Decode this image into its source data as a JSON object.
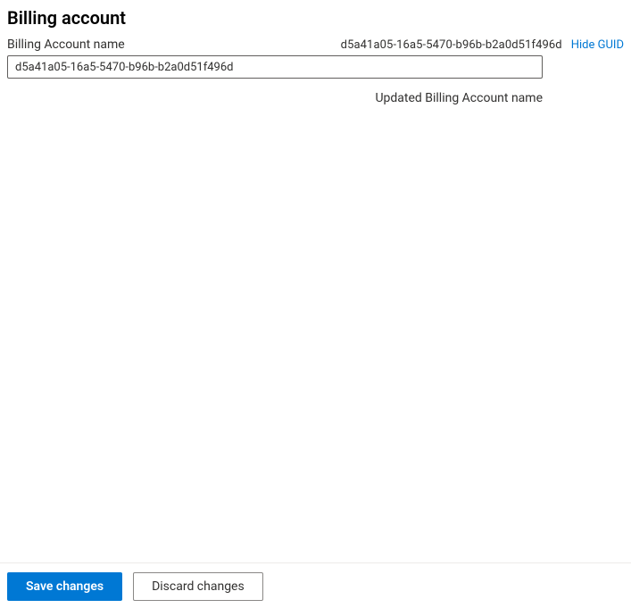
{
  "header": {
    "title": "Billing account"
  },
  "form": {
    "field_label": "Billing Account name",
    "guid": "d5a41a05-16a5-5470-b96b-b2a0d51f496d",
    "hide_guid_label": "Hide GUID",
    "input_value": "d5a41a05-16a5-5470-b96b-b2a0d51f496d",
    "status_text": "Updated Billing Account name"
  },
  "footer": {
    "save_label": "Save changes",
    "discard_label": "Discard changes"
  }
}
